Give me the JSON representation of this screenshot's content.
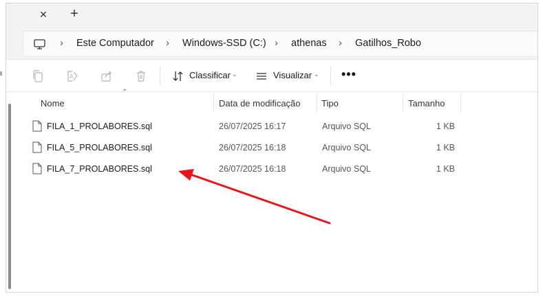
{
  "tabstrip": {
    "close_icon": "close-icon",
    "new_tab_icon": "plus-icon"
  },
  "breadcrumb": {
    "root_icon": "computer-icon",
    "items": [
      "Este Computador",
      "Windows-SSD (C:)",
      "athenas",
      "Gatilhos_Robo"
    ]
  },
  "toolbar": {
    "new_icon": "new-folder-icon",
    "copy_icon": "copy-icon",
    "rename_icon": "rename-icon",
    "share_icon": "share-icon",
    "delete_icon": "delete-icon",
    "sort_label": "Classificar",
    "view_label": "Visualizar",
    "more_label": "•••"
  },
  "columns": {
    "name": "Nome",
    "date": "Data de modificação",
    "type": "Tipo",
    "size": "Tamanho"
  },
  "files": [
    {
      "name": "FILA_1_PROLABORES.sql",
      "date": "26/07/2025 16:17",
      "type": "Arquivo SQL",
      "size": "1 KB"
    },
    {
      "name": "FILA_5_PROLABORES.sql",
      "date": "26/07/2025 16:18",
      "type": "Arquivo SQL",
      "size": "1 KB"
    },
    {
      "name": "FILA_7_PROLABORES.sql",
      "date": "26/07/2025 16:18",
      "type": "Arquivo SQL",
      "size": "1 KB"
    }
  ],
  "colors": {
    "annotation_arrow": "#e8141b",
    "chrome_background": "#f3f3f3"
  }
}
